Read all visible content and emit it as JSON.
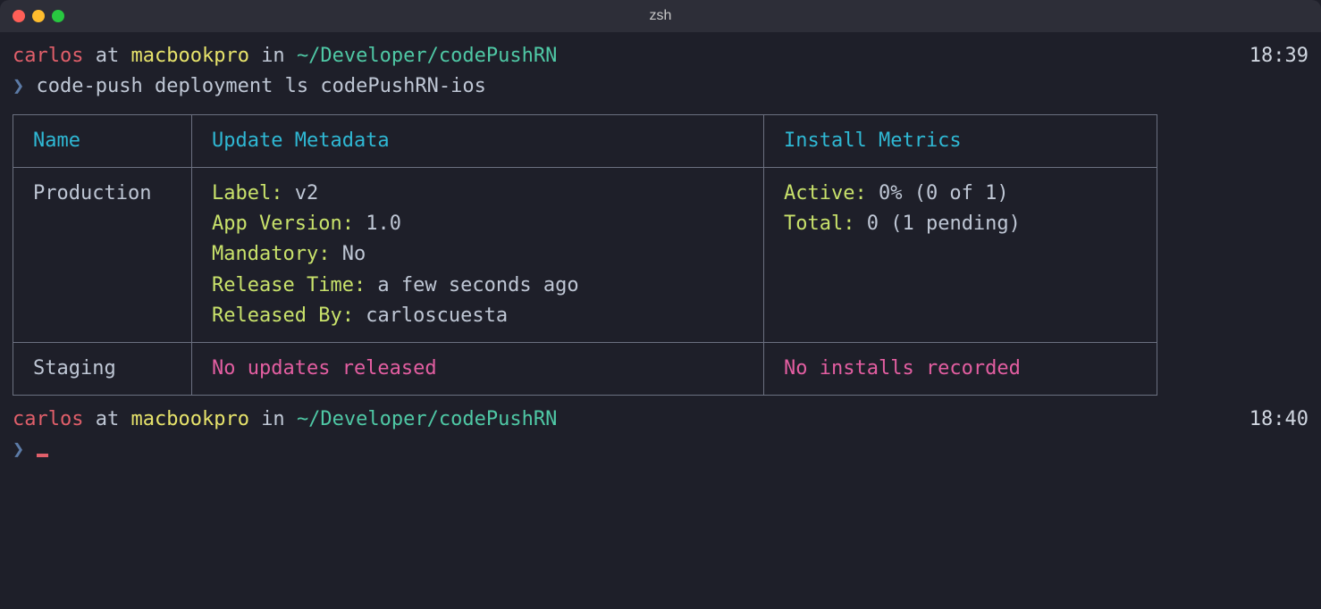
{
  "window": {
    "title": "zsh"
  },
  "prompt1": {
    "user": "carlos",
    "at": "at",
    "host": "macbookpro",
    "in": "in",
    "path": "~/Developer/codePushRN",
    "time": "18:39",
    "command_char": "❯",
    "command": "code-push deployment ls codePushRN-ios"
  },
  "table": {
    "headers": {
      "name": "Name",
      "meta": "Update Metadata",
      "metrics": "Install Metrics"
    },
    "rows": [
      {
        "name": "Production",
        "meta": [
          {
            "k": "Label:",
            "v": " v2"
          },
          {
            "k": "App Version:",
            "v": " 1.0"
          },
          {
            "k": "Mandatory:",
            "v": " No"
          },
          {
            "k": "Release Time:",
            "v": " a few seconds ago"
          },
          {
            "k": "Released By:",
            "v": " carloscuesta"
          }
        ],
        "metrics": [
          {
            "k": "Active:",
            "v": " 0% (0 of 1)"
          },
          {
            "k": "Total:",
            "v": " 0 (1 pending)"
          }
        ]
      },
      {
        "name": "Staging",
        "meta_empty": "No updates released",
        "metrics_empty": "No installs recorded"
      }
    ]
  },
  "prompt2": {
    "user": "carlos",
    "at": "at",
    "host": "macbookpro",
    "in": "in",
    "path": "~/Developer/codePushRN",
    "time": "18:40",
    "command_char": "❯"
  }
}
